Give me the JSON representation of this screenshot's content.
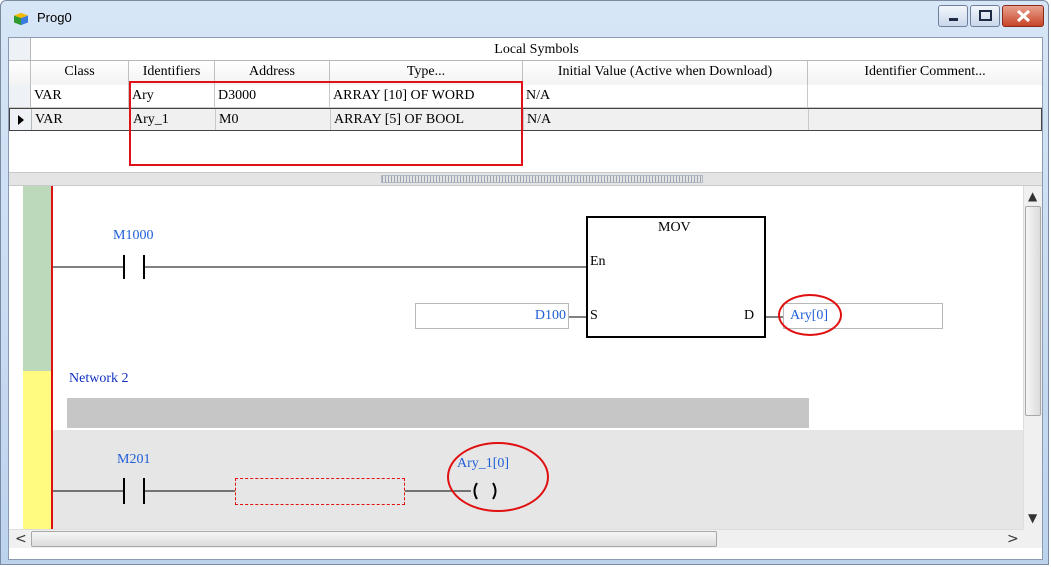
{
  "window": {
    "title": "Prog0",
    "colors": {
      "frame": "#bcd3ee",
      "close_button": "#c7452a",
      "highlight": "#e01010",
      "identifier_blue": "#1f5fd8"
    }
  },
  "symbols": {
    "group_header": "Local Symbols",
    "columns": [
      "Class",
      "Identifiers",
      "Address",
      "Type...",
      "Initial Value (Active when Download)",
      "Identifier Comment..."
    ],
    "rows": [
      {
        "class": "VAR",
        "identifier": "Ary",
        "address": "D3000",
        "type": "ARRAY [10] OF WORD",
        "initial": "N/A",
        "comment": ""
      },
      {
        "class": "VAR",
        "identifier": "Ary_1",
        "address": "M0",
        "type": "ARRAY [5] OF BOOL",
        "initial": "N/A",
        "comment": ""
      }
    ]
  },
  "ladder": {
    "network1": {
      "contact_label": "M1000",
      "instruction": "MOV",
      "pin_en": "En",
      "pin_s": "S",
      "pin_d": "D",
      "source_operand": "D100",
      "dest_operand": "Ary[0]"
    },
    "network2": {
      "label": "Network 2",
      "contact_label": "M201",
      "coil_label": "Ary_1[0]"
    }
  },
  "scrollbars": {
    "left_arrow": "<",
    "right_arrow": ">",
    "up_arrow": "▲",
    "down_arrow": "▼"
  }
}
